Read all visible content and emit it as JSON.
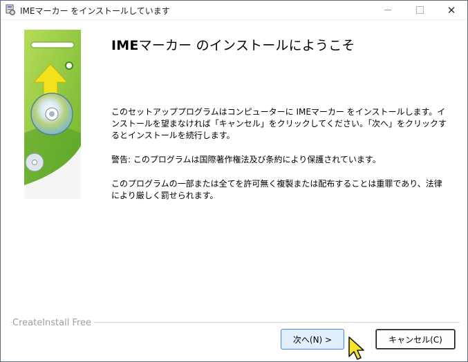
{
  "window": {
    "title": "IMEマーカー をインストールしています",
    "minimize_glyph": "",
    "maximize_glyph": "",
    "close_glyph": "✕"
  },
  "main": {
    "heading_bold": "IME",
    "heading_rest": "マーカー のインストールにようこそ",
    "paragraphs": [
      "このセットアッププログラムはコンピューターに IMEマーカー をインストールします。インストールを望まなければ「キャンセル」をクリックしてください。「次へ」をクリックするとインストールを続行します。",
      "警告: このプログラムは国際著作権法及び条約により保護されています。",
      "このプログラムの一部または全てを許可無く複製または配布することは重罪であり、法律により厳しく罰せられます。"
    ]
  },
  "footer": {
    "brand": "CreateInstall Free",
    "next_label": "次へ(N) >",
    "cancel_label": "キャンセル(C)"
  },
  "icons": {
    "app": "installer-icon",
    "banner_arrow": "upload-arrow-icon",
    "banner_disc": "cd-disc-icon",
    "cursor": "mouse-pointer-icon"
  },
  "colors": {
    "banner_green": "#8cc63f",
    "banner_dark_green": "#3f8f1f",
    "arrow_yellow": "#f2e21c",
    "next_button_border": "#4f8fd6",
    "next_button_fill": "#e2efff"
  }
}
